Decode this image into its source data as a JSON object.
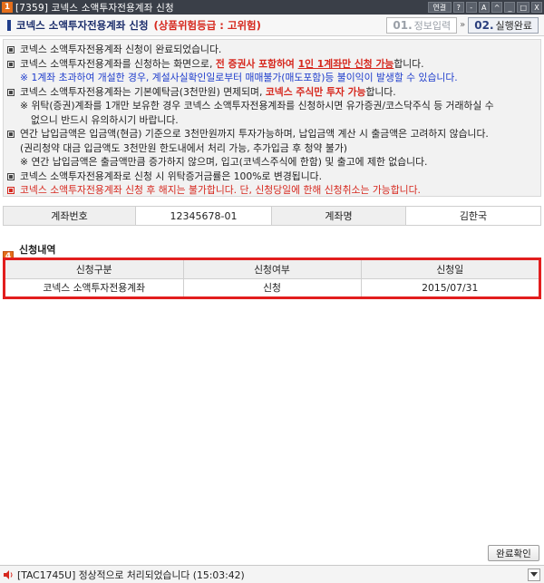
{
  "window": {
    "badge": "1",
    "title": "[7359] 코넥스 소액투자전용계좌 신청",
    "buttons": {
      "link": "연결",
      "help": "?",
      "font_down": "-",
      "font_up": "A",
      "pin": "^",
      "minimize": "_",
      "maximize": "□",
      "close": "X"
    }
  },
  "header": {
    "title": "코넥스 소액투자전용계좌 신청",
    "risk": "(상품위험등급 : 고위험)",
    "steps": [
      {
        "num": "01.",
        "label": "정보입력",
        "active": false
      },
      {
        "num": "02.",
        "label": "실행완료",
        "active": true
      }
    ],
    "step_separator": "»"
  },
  "notice": {
    "lines": [
      {
        "text": "코넥스 소액투자전용계좌 신청이 완료되었습니다."
      },
      {
        "pre": "코넥스 소액투자전용계좌를 신청하는 화면으로, ",
        "em1": "전 증권사 포함하여 ",
        "em2": "1인 1계좌만 신청 가능",
        "post": "합니다."
      },
      {
        "note": "※ 1계좌 초과하여 개설한 경우, 계설사실확인일로부터 매매불가(매도포함)등 불이익이 발생할 수 있습니다."
      },
      {
        "pre": "코넥스 소액투자전용계좌는 기본예탁금(3천만원) 면제되며, ",
        "em": "코넥스 주식만 투자 가능",
        "post": "합니다."
      },
      {
        "note1": "※ 위탁(증권)계좌를 1개만 보유한 경우 코넥스 소액투자전용계좌를 신청하시면 유가증권/코스닥주식 등 거래하실 수",
        "note2": "없으니 반드시 유의하시기 바랍니다."
      },
      {
        "t1": "연간 납입금액은 입금액(현금) 기준으로 3천만원까지 투자가능하며, 납입금액 계산 시 출금액은 고려하지 않습니다.",
        "t2": "(권리청약 대금 입금액도 3천만원 한도내에서 처리 가능, 추가입금 후 청약 불가)",
        "t3": "※ 연간 납입금액은 출금액만큼 증가하지 않으며, 입고(코넥스주식에 한함) 및 출고에 제한 없습니다."
      },
      {
        "text": "코넥스 소액투자전용계좌로 신청 시 위탁증거금률은 100%로 변경됩니다."
      },
      {
        "red": "코넥스 소액투자전용계좌 신청 후 해지는 불가합니다. 단, 신청당일에 한해 신청취소는 가능합니다."
      }
    ]
  },
  "account": {
    "number_label": "계좌번호",
    "number_value": "12345678-01",
    "name_label": "계좌명",
    "name_value": "김한국"
  },
  "section": {
    "badge": "4",
    "title": "신청내역"
  },
  "table": {
    "headers": [
      "신청구분",
      "신청여부",
      "신청일"
    ],
    "rows": [
      [
        "코넥스 소액투자전용계좌",
        "신청",
        "2015/07/31"
      ]
    ]
  },
  "confirm_button": "완료확인",
  "status": {
    "message": "[TAC1745U] 정상적으로 처리되었습니다 (15:03:42)"
  },
  "colors": {
    "accent_red": "#d6281e",
    "title_navy": "#1b2d6b",
    "badge_orange": "#e46e1b",
    "titlebar_bg": "#3a3f48"
  }
}
